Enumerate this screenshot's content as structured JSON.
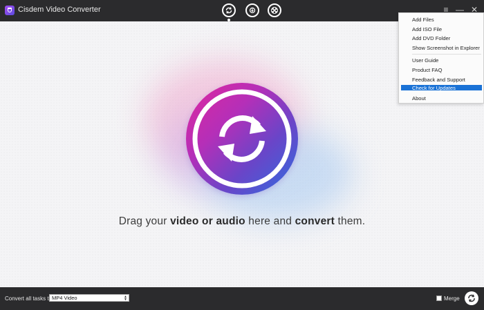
{
  "app": {
    "title": "Cisdem Video Converter"
  },
  "toolbar": {
    "modes": [
      {
        "name": "convert",
        "icon": "convert-icon",
        "active": true
      },
      {
        "name": "download",
        "icon": "download-icon",
        "active": false
      },
      {
        "name": "rip",
        "icon": "film-reel-icon",
        "active": false
      }
    ],
    "window_controls": [
      "menu-icon",
      "minimize-icon",
      "close-icon"
    ]
  },
  "menu": {
    "items": [
      {
        "label": "Add Files"
      },
      {
        "label": "Add ISO File"
      },
      {
        "label": "Add DVD Folder"
      },
      {
        "label": "Show Screenshot in Explorer"
      },
      {
        "label": "User Guide"
      },
      {
        "label": "Product FAQ"
      },
      {
        "label": "Feedback and Support"
      },
      {
        "label": "Check for Updates",
        "highlighted": true
      },
      {
        "label": "About"
      }
    ],
    "highlight_color": "#1a72d6"
  },
  "main": {
    "drop_text": {
      "part1": "Drag your ",
      "bold1": "video or audio",
      "part2": " here and ",
      "bold2": "convert",
      "part3": " them."
    }
  },
  "bottom": {
    "convert_label": "Convert all tasks to",
    "format_value": "MP4 Video",
    "merge_label": "Merge",
    "merge_checked": false
  },
  "colors": {
    "bar_bg": "#2b2b2d",
    "circle_gradient": [
      "#e0279d",
      "#b52fb8",
      "#6a45c8",
      "#2f6de0"
    ]
  }
}
